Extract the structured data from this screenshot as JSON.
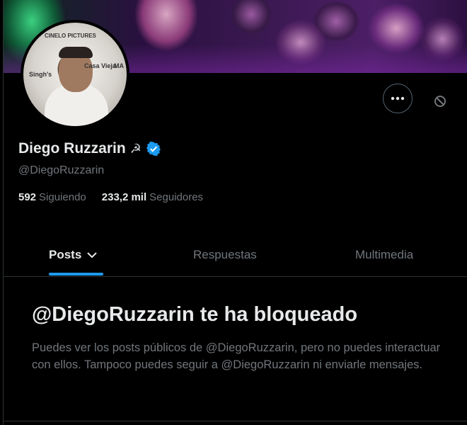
{
  "profile": {
    "display_name": "Diego Ruzzarin",
    "name_emoji": "☭",
    "handle": "@DiegoRuzzarin",
    "following_count": "592",
    "following_label": "Siguiendo",
    "followers_count": "233,2 mil",
    "followers_label": "Seguidores"
  },
  "avatar_text": {
    "sponsor_1": "CINELO PICTURES",
    "sponsor_2": "Singh's",
    "sponsor_3": "Casa Vieja",
    "sponsor_4": "MA"
  },
  "actions": {
    "more_icon": "more-horizontal-icon",
    "block_icon": "block-icon"
  },
  "tabs": [
    {
      "label": "Posts",
      "active": true
    },
    {
      "label": "Respuestas",
      "active": false
    },
    {
      "label": "Multimedia",
      "active": false
    }
  ],
  "blocked": {
    "title": "@DiegoRuzzarin te ha bloqueado",
    "description": "Puedes ver los posts públicos de @DiegoRuzzarin, pero no puedes interactuar con ellos. Tampoco puedes seguir a @DiegoRuzzarin ni enviarle mensajes."
  },
  "colors": {
    "background": "#000000",
    "accent": "#1d9bf0",
    "text_primary": "#e7e9ea",
    "text_secondary": "#71767b",
    "divider": "#2f3336"
  }
}
